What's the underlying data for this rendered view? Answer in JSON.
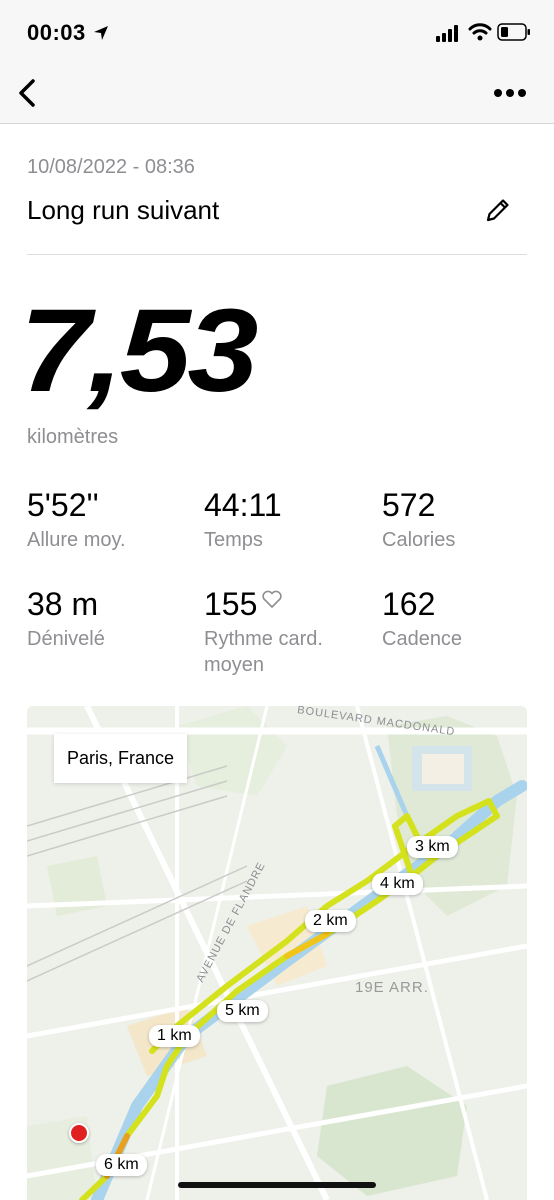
{
  "status_bar": {
    "time": "00:03",
    "icons": [
      "location-arrow-icon",
      "cellular-signal-icon",
      "wifi-icon",
      "battery-icon"
    ]
  },
  "nav": {
    "back_icon": "chevron-left-icon",
    "more_icon": "ellipsis-icon"
  },
  "activity": {
    "date": "10/08/2022 - 08:36",
    "title": "Long run suivant",
    "edit_icon": "pencil-icon",
    "distance": "7,53",
    "distance_unit": "kilomètres"
  },
  "stats": [
    {
      "value": "5'52''",
      "label": "Allure moy."
    },
    {
      "value": "44:11",
      "label": "Temps"
    },
    {
      "value": "572",
      "label": "Calories"
    },
    {
      "value": "38 m",
      "label": "Dénivelé"
    },
    {
      "value": "155",
      "label": "Rythme card. moyen",
      "icon": "heart-icon"
    },
    {
      "value": "162",
      "label": "Cadence"
    }
  ],
  "map": {
    "location": "Paris, France",
    "street_labels": [
      "BOULEVARD MACDONALD",
      "AVENUE DE FLANDRE",
      "19E ARR."
    ],
    "km_markers": [
      "3 km",
      "4 km",
      "2 km",
      "5 km",
      "1 km",
      "6 km"
    ],
    "route_colors": {
      "fast": "#d4e21e",
      "medium": "#f0c419",
      "slow": "#e8a020",
      "start": "#e02020"
    }
  }
}
